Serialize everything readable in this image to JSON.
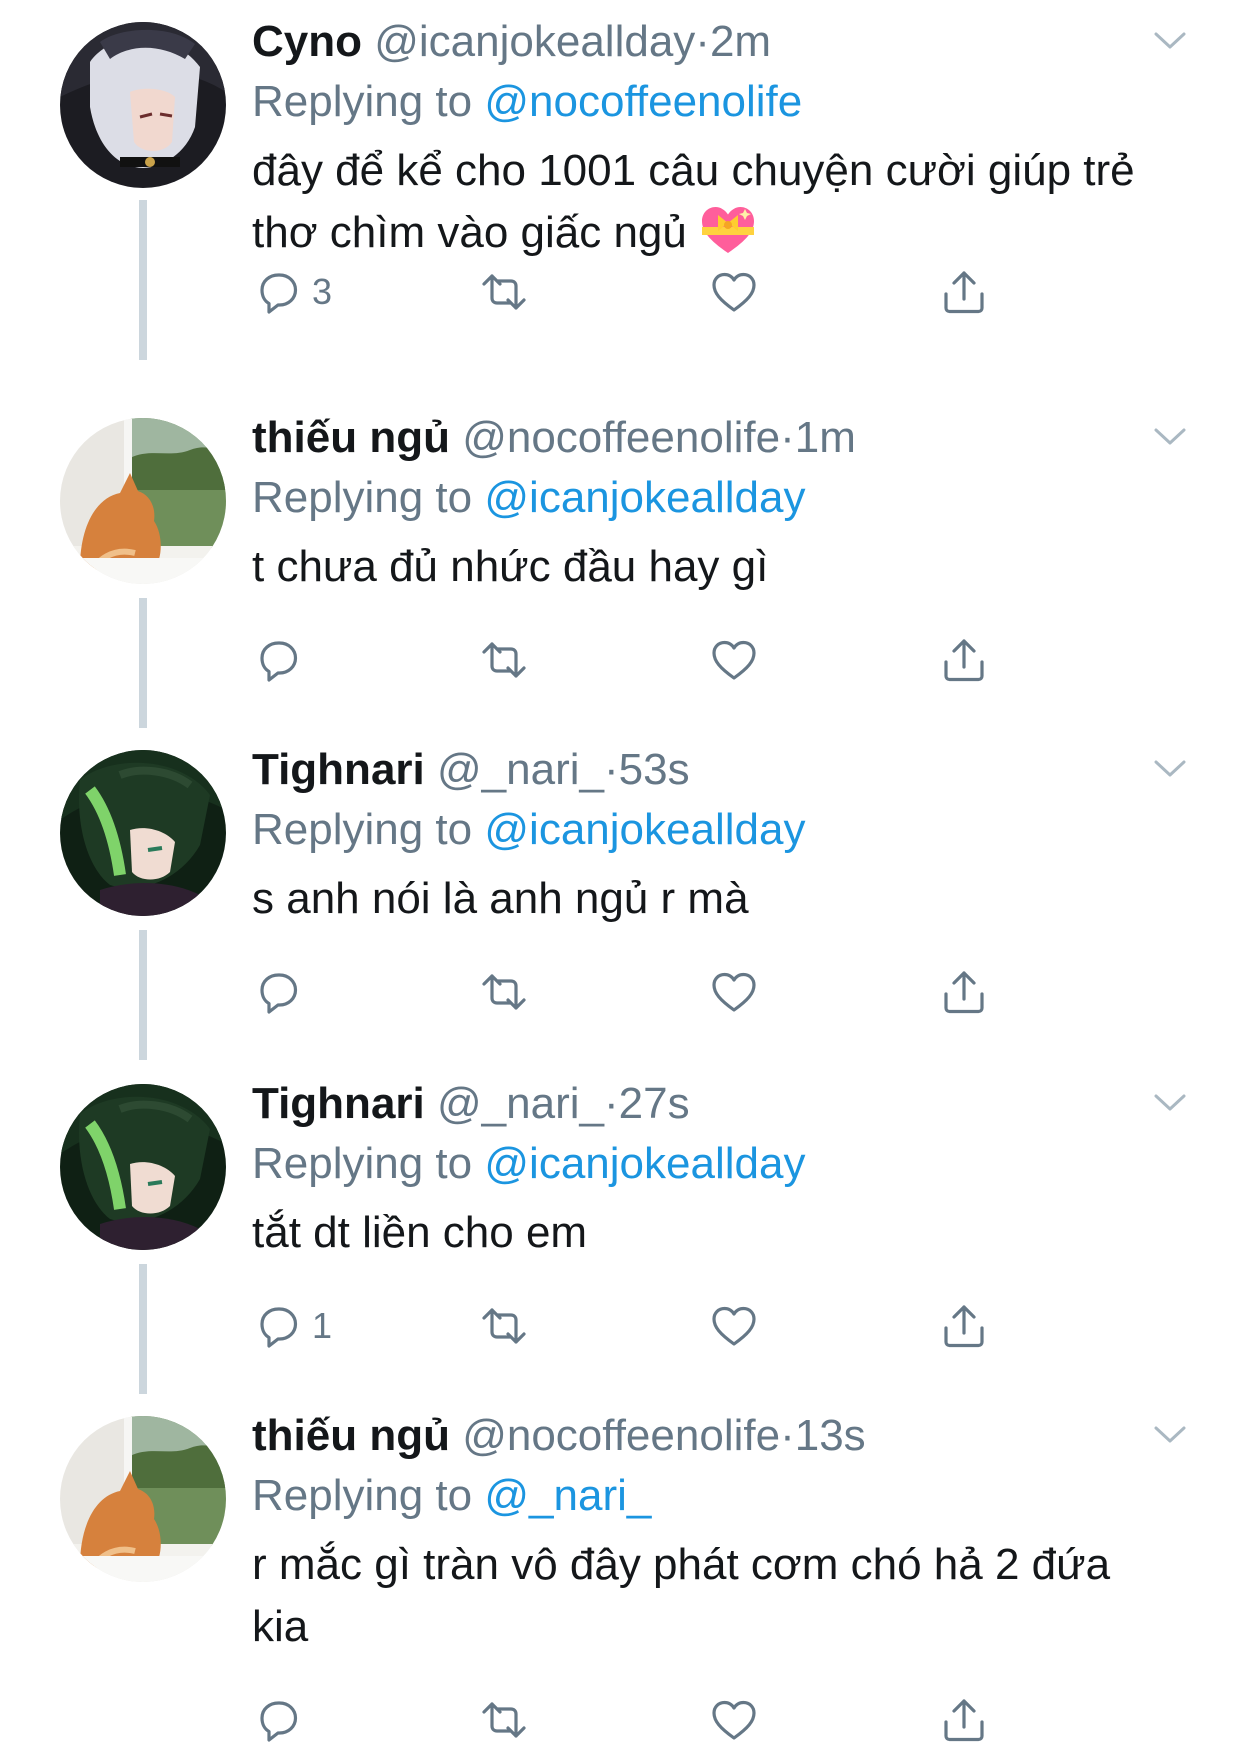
{
  "tweets": [
    {
      "name": "Cyno",
      "handle": "@icanjokeallday",
      "separator": "·",
      "time": "2m",
      "replying_prefix": "Replying to",
      "replying_to": "@nocoffeenolife",
      "text": "đây để kể cho 1001 câu chuyện cười giúp trẻ thơ chìm vào giấc ngủ",
      "emoji": "sparkling-heart-with-ribbon",
      "reply_count": "3",
      "retweet_count": "",
      "like_count": "",
      "avatar": "white-haired-anime-avatar"
    },
    {
      "name": "thiếu ngủ",
      "handle": "@nocoffeenolife",
      "separator": "·",
      "time": "1m",
      "replying_prefix": "Replying to",
      "replying_to": "@icanjokeallday",
      "text": "t chưa đủ nhức đầu hay gì",
      "reply_count": "",
      "retweet_count": "",
      "like_count": "",
      "avatar": "orange-cat-window-avatar"
    },
    {
      "name": "Tighnari",
      "handle": "@_nari_",
      "separator": "·",
      "time": "53s",
      "replying_prefix": "Replying to",
      "replying_to": "@icanjokeallday",
      "text": "s anh nói là anh ngủ r mà",
      "reply_count": "",
      "retweet_count": "",
      "like_count": "",
      "avatar": "green-haired-anime-avatar"
    },
    {
      "name": "Tighnari",
      "handle": "@_nari_",
      "separator": "·",
      "time": "27s",
      "replying_prefix": "Replying to",
      "replying_to": "@icanjokeallday",
      "text": "tắt dt liền cho em",
      "reply_count": "1",
      "retweet_count": "",
      "like_count": "",
      "avatar": "green-haired-anime-avatar"
    },
    {
      "name": "thiếu ngủ",
      "handle": "@nocoffeenolife",
      "separator": "·",
      "time": "13s",
      "replying_prefix": "Replying to",
      "replying_to": "@_nari_",
      "text": "r mắc gì tràn vô đây phát cơm chó hả 2 đứa kia",
      "reply_count": "",
      "retweet_count": "",
      "like_count": "",
      "avatar": "orange-cat-window-avatar"
    }
  ],
  "colors": {
    "link": "#1b95e0",
    "secondary": "#657786",
    "primary": "#14171a",
    "thread_line": "#ccd6dd",
    "icon": "#657786"
  }
}
